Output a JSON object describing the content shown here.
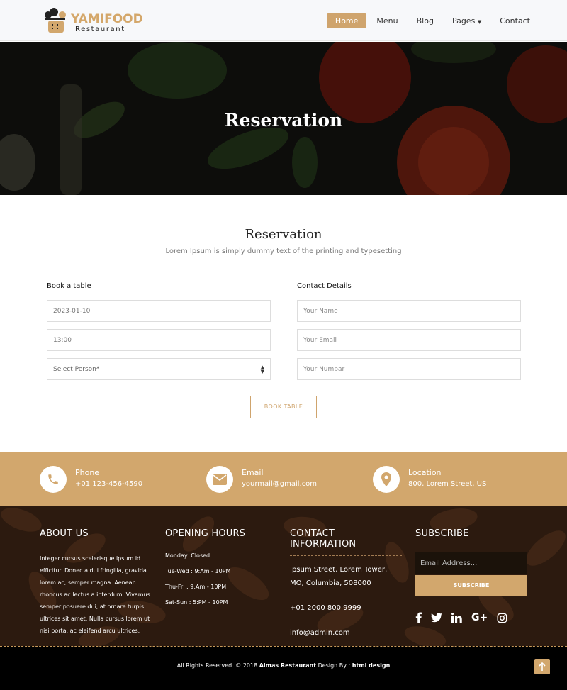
{
  "brand": {
    "name": "YAMIFOOD",
    "tagline": "Restaurant"
  },
  "nav": {
    "items": [
      {
        "label": "Home",
        "active": true
      },
      {
        "label": "Menu"
      },
      {
        "label": "Blog"
      },
      {
        "label": "Pages",
        "dropdown": true
      },
      {
        "label": "Contact"
      }
    ]
  },
  "hero": {
    "title": "Reservation"
  },
  "reservation": {
    "title": "Reservation",
    "subtitle": "Lorem Ipsum is simply dummy text of the printing and typesetting",
    "book_heading": "Book a table",
    "contact_heading": "Contact Details",
    "date_value": "2023-01-10",
    "time_value": "13:00",
    "person_select": "Select Person*",
    "name_placeholder": "Your Name",
    "email_placeholder": "Your Email",
    "number_placeholder": "Your Numbar",
    "button": "BOOK TABLE"
  },
  "contact_band": {
    "phone": {
      "label": "Phone",
      "value": "+01 123-456-4590"
    },
    "email": {
      "label": "Email",
      "value": "yourmail@gmail.com"
    },
    "location": {
      "label": "Location",
      "value": "800, Lorem Street, US"
    }
  },
  "footer": {
    "about": {
      "heading": "ABOUT US",
      "text": "Integer cursus scelerisque ipsum id efficitur. Donec a dui fringilla, gravida lorem ac, semper magna. Aenean rhoncus ac lectus a interdum. Vivamus semper posuere dui, at ornare turpis ultrices sit amet. Nulla cursus lorem ut nisi porta, ac eleifend arcu ultrices."
    },
    "hours": {
      "heading": "OPENING HOURS",
      "lines": [
        "Monday: Closed",
        "Tue-Wed : 9:Am - 10PM",
        "Thu-Fri : 9:Am - 10PM",
        "Sat-Sun : 5:PM - 10PM"
      ]
    },
    "contact": {
      "heading": "CONTACT INFORMATION",
      "address": "Ipsum Street, Lorem Tower, MO, Columbia, 508000",
      "phone": "+01 2000 800 9999",
      "email": "info@admin.com"
    },
    "subscribe": {
      "heading": "SUBSCRIBE",
      "placeholder": "Email Address...",
      "button": "SUBSCRIBE",
      "socials": [
        "facebook-icon",
        "twitter-icon",
        "linkedin-icon",
        "google-plus-icon",
        "instagram-icon"
      ]
    }
  },
  "bottom": {
    "prefix": "All Rights Reserved. © 2018 ",
    "company": "Almas Restaurant",
    "mid": " Design By : ",
    "designer": "html design"
  },
  "colors": {
    "accent": "#d2a76d",
    "footer_bg": "#3a2415"
  }
}
